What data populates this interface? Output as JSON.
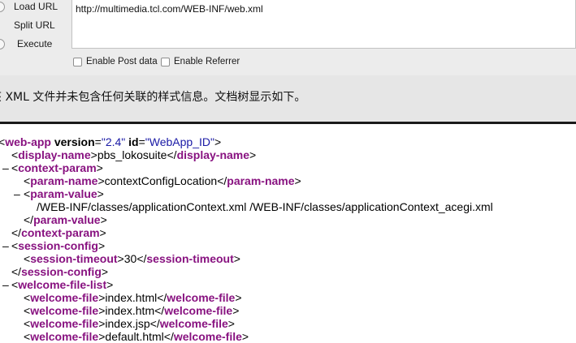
{
  "toolbar": {
    "load_url": "Load URL",
    "split_url": "Split URL",
    "execute": "Execute",
    "url_value": "http://multimedia.tcl.com/WEB-INF/web.xml",
    "enable_post": "Enable Post data",
    "enable_referrer": "Enable Referrer"
  },
  "notice": "该 XML 文件并未包含任何关联的样式信息。文档树显示如下。",
  "xml": {
    "root_tag": "web-app",
    "root_attr_version_name": "version",
    "root_attr_version_value": "\"2.4\"",
    "root_attr_id_name": "id",
    "root_attr_id_value": "\"WebApp_ID\"",
    "display_name_tag": "display-name",
    "display_name_value": "pbs_lokosuite",
    "context_param_tag": "context-param",
    "param_name_tag": "param-name",
    "param_name_value": "contextConfigLocation",
    "param_value_tag": "param-value",
    "param_value_text": "/WEB-INF/classes/applicationContext.xml /WEB-INF/classes/applicationContext_acegi.xml",
    "session_config_tag": "session-config",
    "session_timeout_tag": "session-timeout",
    "session_timeout_value": "30",
    "welcome_file_list_tag": "welcome-file-list",
    "welcome_file_tag": "welcome-file",
    "welcome_files": [
      "index.html",
      "index.htm",
      "index.jsp",
      "default.html"
    ]
  }
}
